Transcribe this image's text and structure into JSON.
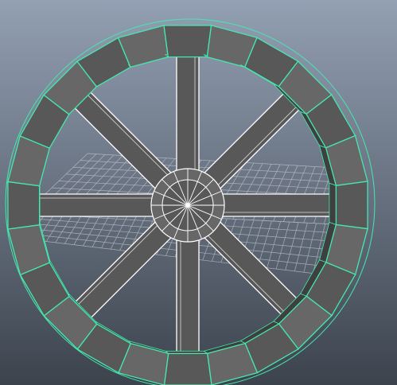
{
  "viewport": {
    "background_top": "#93a0b3",
    "background_bottom": "#3c434d",
    "grid_color": "#c4c8ce"
  },
  "model": {
    "segment_count": 24,
    "spoke_count": 8,
    "face_color": "#585858",
    "face_color_light": "#676767",
    "selection_edge_color": "#45e8ae",
    "wire_color": "#ffffff"
  }
}
